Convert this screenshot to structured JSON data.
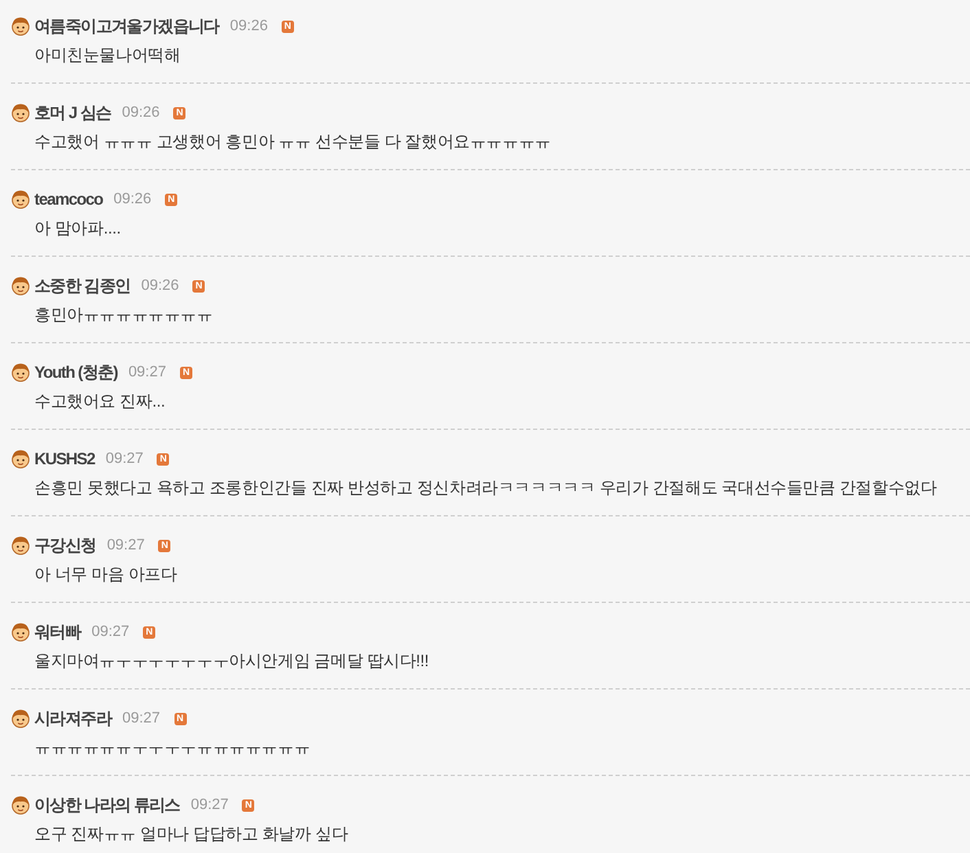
{
  "comments": [
    {
      "author": "여름죽이고겨울가겠읍니다",
      "time": "09:26",
      "badge": "N",
      "text": "아미친눈물나어떡해"
    },
    {
      "author": "호머 J 심슨",
      "time": "09:26",
      "badge": "N",
      "text": "수고했어 ㅠㅠㅠ 고생했어 흥민아 ㅠㅠ 선수분들 다 잘했어요ㅠㅠㅠㅠㅠ"
    },
    {
      "author": "teamcoco",
      "time": "09:26",
      "badge": "N",
      "text": "아 맘아파...."
    },
    {
      "author": "소중한 김종인",
      "time": "09:26",
      "badge": "N",
      "text": "흥민아ㅠㅠㅠㅠㅠㅠㅠㅠ"
    },
    {
      "author": "Youth (청춘)",
      "time": "09:27",
      "badge": "N",
      "text": "수고했어요 진짜..."
    },
    {
      "author": "KUSHS2",
      "time": "09:27",
      "badge": "N",
      "text": "손흥민 못했다고 욕하고 조롱한인간들 진짜 반성하고 정신차려라ㅋㅋㅋㅋㅋㅋ 우리가 간절해도 국대선수들만큼 간절할수없다"
    },
    {
      "author": "구강신청",
      "time": "09:27",
      "badge": "N",
      "text": "아 너무 마음 아프다"
    },
    {
      "author": "워터빠",
      "time": "09:27",
      "badge": "N",
      "text": "울지마여ㅠㅜㅜㅜㅜㅜㅜㅜ아시안게임 금메달 땁시다!!!"
    },
    {
      "author": "시라져주라",
      "time": "09:27",
      "badge": "N",
      "text": "ㅠㅠㅠㅠㅠㅠㅜㅜㅜㅜㅠㅠㅠㅠㅠㅠㅠ"
    },
    {
      "author": "이상한 나라의 류리스",
      "time": "09:27",
      "badge": "N",
      "text": "오구 진짜ㅠㅠ 얼마나 답답하고 화날까 싶다"
    }
  ]
}
